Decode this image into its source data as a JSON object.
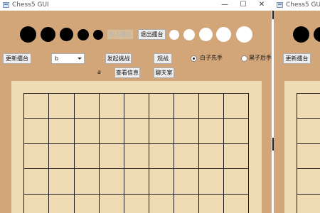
{
  "window": {
    "title": "Chess5 GUI",
    "controls": {
      "minimize": "—",
      "maximize": "☐",
      "close": "✕"
    }
  },
  "second_window": {
    "title": "Chess5 GUI"
  },
  "toolbar": {
    "join_arena": "加入擂台",
    "leave_arena": "退出擂台",
    "refresh_arena": "更新擂台",
    "arena_select_value": "b",
    "start_challenge": "发起挑战",
    "spectate": "观战",
    "white_first": "白子先手",
    "black_second": "黑子后手",
    "player_name": "a",
    "view_info": "查看信息",
    "chat_room": "聊天室"
  },
  "stones": {
    "black_count": 5,
    "white_count": 5
  },
  "board": {
    "background": "#f0dcb4",
    "line_color": "#1a1a1a",
    "frame_color": "#d2a679"
  },
  "colors": {
    "window_bg": "#d2a679"
  }
}
